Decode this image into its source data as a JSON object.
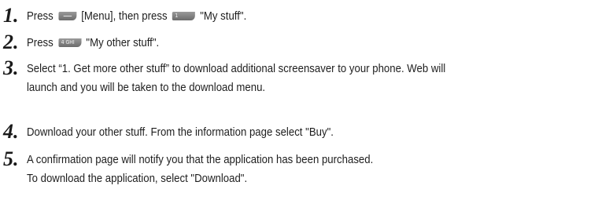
{
  "steps": [
    {
      "number": "1.",
      "text_before": "Press",
      "menu_key_icon": "menu-soft-key-icon",
      "text_middle": "[Menu], then press",
      "key_icon": "key-1-icon",
      "key_label": "1",
      "text_after": "\"My stuff\"."
    },
    {
      "number": "2.",
      "text_before": "Press",
      "key_icon": "key-4-icon",
      "key_label": "4 GHI",
      "text_after": "\"My other stuff\"."
    },
    {
      "number": "3.",
      "line1": "Select “1. Get more other stuff” to download additional screensaver to your phone.  Web will",
      "line2": "launch and you will be taken to the download menu."
    },
    {
      "number": "4.",
      "line1": "Download your other stuff.  From the information page select \"Buy\"."
    },
    {
      "number": "5.",
      "line1": "A confirmation page will notify you that the application has been purchased.",
      "line2": "To download the application, select \"Download\"."
    }
  ]
}
